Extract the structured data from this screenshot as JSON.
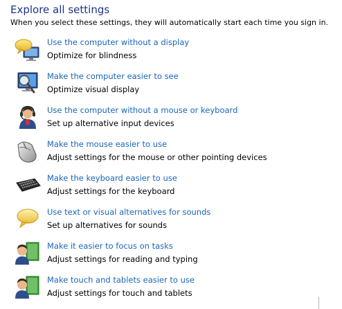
{
  "heading": "Explore all settings",
  "subtitle": "When you select these settings, they will automatically start each time you sign in.",
  "items": [
    {
      "link": "Use the computer without a display",
      "description": "Optimize for blindness",
      "icon": "speech-bubble-monitor-icon"
    },
    {
      "link": "Make the computer easier to see",
      "description": "Optimize visual display",
      "icon": "magnifier-monitor-icon"
    },
    {
      "link": "Use the computer without a mouse or keyboard",
      "description": "Set up alternative input devices",
      "icon": "user-headset-icon"
    },
    {
      "link": "Make the mouse easier to use",
      "description": "Adjust settings for the mouse or other pointing devices",
      "icon": "mouse-icon"
    },
    {
      "link": "Make the keyboard easier to use",
      "description": "Adjust settings for the keyboard",
      "icon": "keyboard-icon"
    },
    {
      "link": "Use text or visual alternatives for sounds",
      "description": "Set up alternatives for sounds",
      "icon": "speech-bubble-icon"
    },
    {
      "link": "Make it easier to focus on tasks",
      "description": "Adjust settings for reading and typing",
      "icon": "user-book-icon"
    },
    {
      "link": "Make touch and tablets easier to use",
      "description": "Adjust settings for touch and tablets",
      "icon": "user-book-icon"
    }
  ]
}
